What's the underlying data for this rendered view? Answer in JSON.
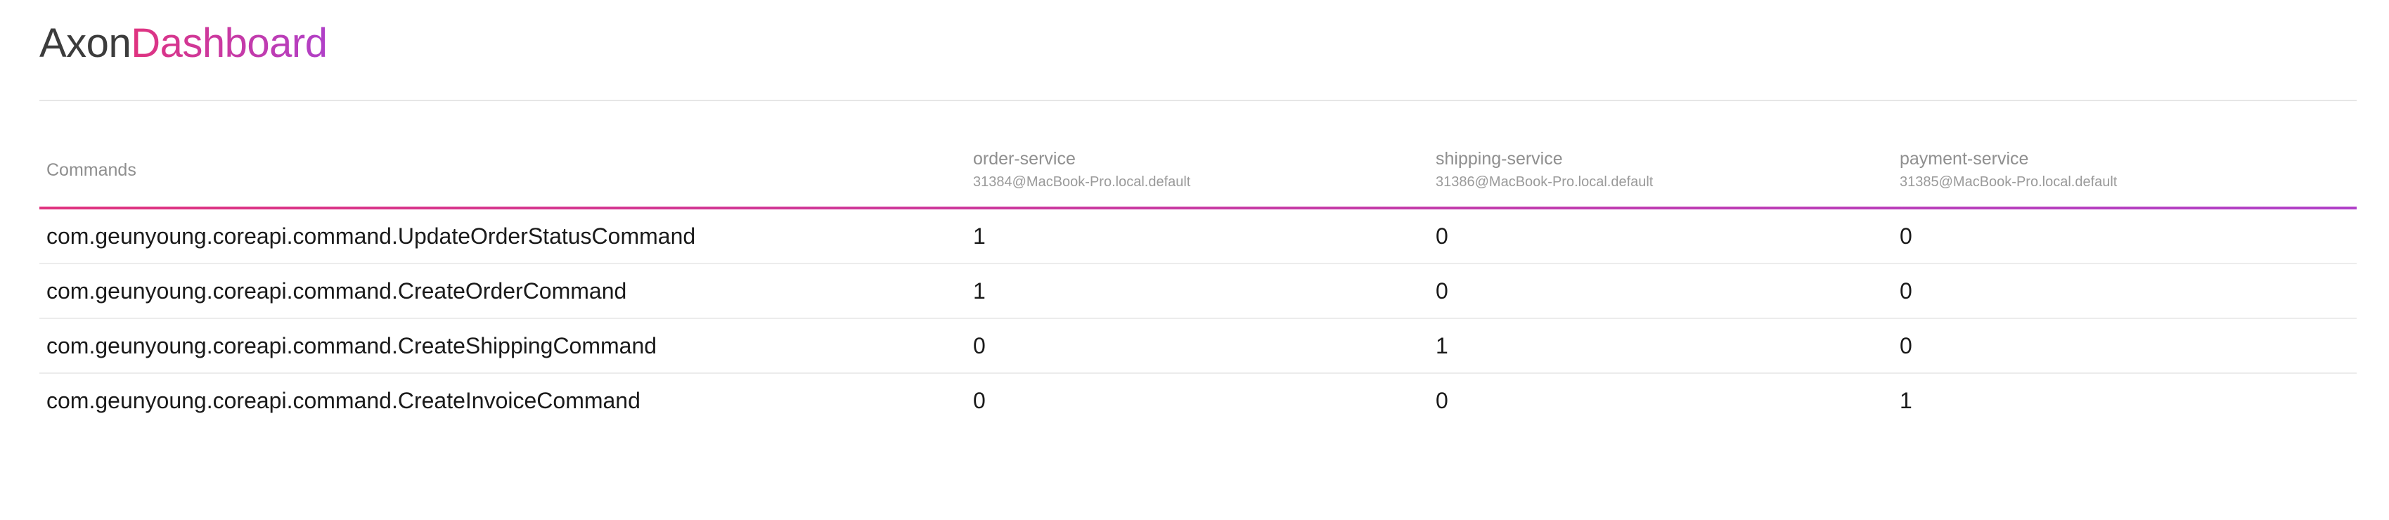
{
  "brand": {
    "part1": "Axon",
    "part2": "Dashboard",
    "colors": {
      "axon": "#3c3c3c",
      "gradient_start": "#e0337f",
      "gradient_end": "#b040c8"
    }
  },
  "table": {
    "header_label": "Commands",
    "services": [
      {
        "name": "order-service",
        "instance": "31384@MacBook-Pro.local.default"
      },
      {
        "name": "shipping-service",
        "instance": "31386@MacBook-Pro.local.default"
      },
      {
        "name": "payment-service",
        "instance": "31385@MacBook-Pro.local.default"
      }
    ],
    "rows": [
      {
        "command": "com.geunyoung.coreapi.command.UpdateOrderStatusCommand",
        "counts": [
          "1",
          "0",
          "0"
        ]
      },
      {
        "command": "com.geunyoung.coreapi.command.CreateOrderCommand",
        "counts": [
          "1",
          "0",
          "0"
        ]
      },
      {
        "command": "com.geunyoung.coreapi.command.CreateShippingCommand",
        "counts": [
          "0",
          "1",
          "0"
        ]
      },
      {
        "command": "com.geunyoung.coreapi.command.CreateInvoiceCommand",
        "counts": [
          "0",
          "0",
          "1"
        ]
      }
    ]
  }
}
